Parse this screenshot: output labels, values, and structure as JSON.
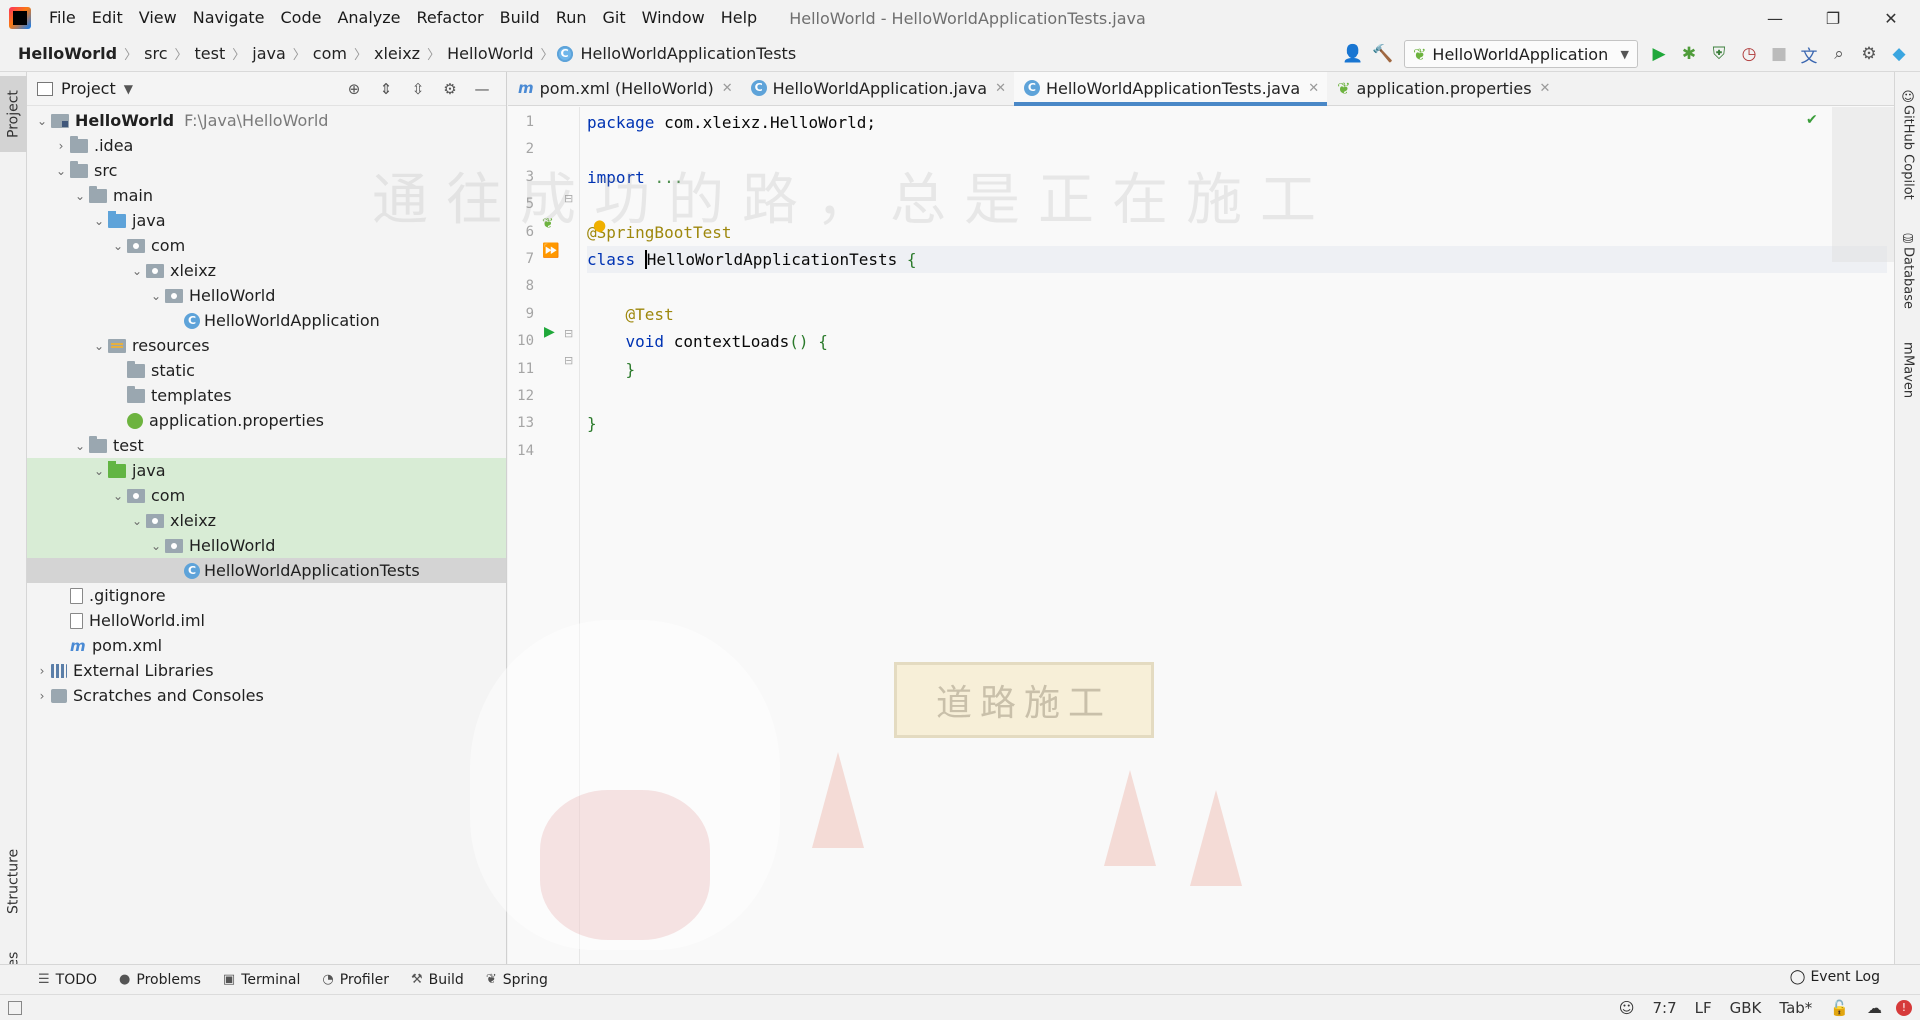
{
  "window": {
    "title": "HelloWorld - HelloWorldApplicationTests.java",
    "controls": [
      "—",
      "❐",
      "✕"
    ]
  },
  "menu": [
    "File",
    "Edit",
    "View",
    "Navigate",
    "Code",
    "Analyze",
    "Refactor",
    "Build",
    "Run",
    "Git",
    "Window",
    "Help"
  ],
  "breadcrumb": [
    "HelloWorld",
    "src",
    "test",
    "java",
    "com",
    "xleixz",
    "HelloWorld",
    "HelloWorldApplicationTests"
  ],
  "run_config": {
    "label": "HelloWorldApplication"
  },
  "left_tabs": {
    "project": "Project",
    "structure": "Structure",
    "favorites": "Favorites"
  },
  "project_panel": {
    "title": "Project",
    "tree": [
      {
        "label": "HelloWorld",
        "path": "F:\\Java\\HelloWorld",
        "depth": 0,
        "chev": "⌄",
        "icon": "module",
        "root": true
      },
      {
        "label": ".idea",
        "depth": 1,
        "chev": "›",
        "icon": "folder"
      },
      {
        "label": "src",
        "depth": 1,
        "chev": "⌄",
        "icon": "folder"
      },
      {
        "label": "main",
        "depth": 2,
        "chev": "⌄",
        "icon": "folder"
      },
      {
        "label": "java",
        "depth": 3,
        "chev": "⌄",
        "icon": "src"
      },
      {
        "label": "com",
        "depth": 4,
        "chev": "⌄",
        "icon": "pkg"
      },
      {
        "label": "xleixz",
        "depth": 5,
        "chev": "⌄",
        "icon": "pkg"
      },
      {
        "label": "HelloWorld",
        "depth": 6,
        "chev": "⌄",
        "icon": "pkg"
      },
      {
        "label": "HelloWorldApplication",
        "depth": 7,
        "chev": "",
        "icon": "class"
      },
      {
        "label": "resources",
        "depth": 3,
        "chev": "⌄",
        "icon": "res"
      },
      {
        "label": "static",
        "depth": 4,
        "chev": "",
        "icon": "folder"
      },
      {
        "label": "templates",
        "depth": 4,
        "chev": "",
        "icon": "folder"
      },
      {
        "label": "application.properties",
        "depth": 4,
        "chev": "",
        "icon": "props"
      },
      {
        "label": "test",
        "depth": 2,
        "chev": "⌄",
        "icon": "folder"
      },
      {
        "label": "java",
        "depth": 3,
        "chev": "⌄",
        "icon": "testsrc",
        "test": true
      },
      {
        "label": "com",
        "depth": 4,
        "chev": "⌄",
        "icon": "pkg",
        "test": true
      },
      {
        "label": "xleixz",
        "depth": 5,
        "chev": "⌄",
        "icon": "pkg",
        "test": true
      },
      {
        "label": "HelloWorld",
        "depth": 6,
        "chev": "⌄",
        "icon": "pkg",
        "test": true
      },
      {
        "label": "HelloWorldApplicationTests",
        "depth": 7,
        "chev": "",
        "icon": "class",
        "selected": true
      },
      {
        "label": ".gitignore",
        "depth": 1,
        "chev": "",
        "icon": "file"
      },
      {
        "label": "HelloWorld.iml",
        "depth": 1,
        "chev": "",
        "icon": "file"
      },
      {
        "label": "pom.xml",
        "depth": 1,
        "chev": "",
        "icon": "maven"
      },
      {
        "label": "External Libraries",
        "depth": 0,
        "chev": "›",
        "icon": "lib"
      },
      {
        "label": "Scratches and Consoles",
        "depth": 0,
        "chev": "›",
        "icon": "scratch"
      }
    ]
  },
  "editor_tabs": [
    {
      "label": "pom.xml (HelloWorld)",
      "icon": "maven",
      "active": false
    },
    {
      "label": "HelloWorldApplication.java",
      "icon": "class",
      "active": false
    },
    {
      "label": "HelloWorldApplicationTests.java",
      "icon": "class",
      "active": true
    },
    {
      "label": "application.properties",
      "icon": "props",
      "active": false
    }
  ],
  "code": {
    "line_numbers": [
      "1",
      "2",
      "3",
      "5",
      "6",
      "7",
      "8",
      "9",
      "10",
      "11",
      "12",
      "13",
      "14"
    ],
    "lines": [
      [
        {
          "t": "package ",
          "c": "kw"
        },
        {
          "t": "com.xleixz.HelloWorld;",
          "c": "id"
        }
      ],
      [],
      [
        {
          "t": "import ",
          "c": "kw"
        },
        {
          "t": "...",
          "c": "fold"
        }
      ],
      [],
      [
        {
          "t": "@SpringBootTest",
          "c": "ann"
        }
      ],
      [
        {
          "t": "class ",
          "c": "kw"
        },
        {
          "t": "HelloWorldApplicationTests",
          "c": "id",
          "cursor": true
        },
        {
          "t": " {",
          "c": "br"
        }
      ],
      [],
      [
        {
          "t": "    @Test",
          "c": "ann"
        }
      ],
      [
        {
          "t": "    void ",
          "c": "kw"
        },
        {
          "t": "contextLoads",
          "c": "id"
        },
        {
          "t": "() {",
          "c": "br"
        }
      ],
      [
        {
          "t": "    }",
          "c": "br"
        }
      ],
      [],
      [
        {
          "t": "}",
          "c": "br"
        }
      ],
      []
    ]
  },
  "watermark": {
    "text": "通往成功的路，总是正在施工",
    "sign": "道路施工"
  },
  "right_tabs": [
    "GitHub Copilot",
    "Database",
    "Maven"
  ],
  "bottom_tabs": [
    {
      "label": "TODO",
      "icon": "☰"
    },
    {
      "label": "Problems",
      "icon": "●"
    },
    {
      "label": "Terminal",
      "icon": "▣"
    },
    {
      "label": "Profiler",
      "icon": "◔"
    },
    {
      "label": "Build",
      "icon": "⚒"
    },
    {
      "label": "Spring",
      "icon": "❦"
    }
  ],
  "event_log": "Event Log",
  "status": {
    "position": "7:7",
    "line_sep": "LF",
    "encoding": "GBK",
    "indent": "Tab*",
    "error_badge": "!"
  }
}
